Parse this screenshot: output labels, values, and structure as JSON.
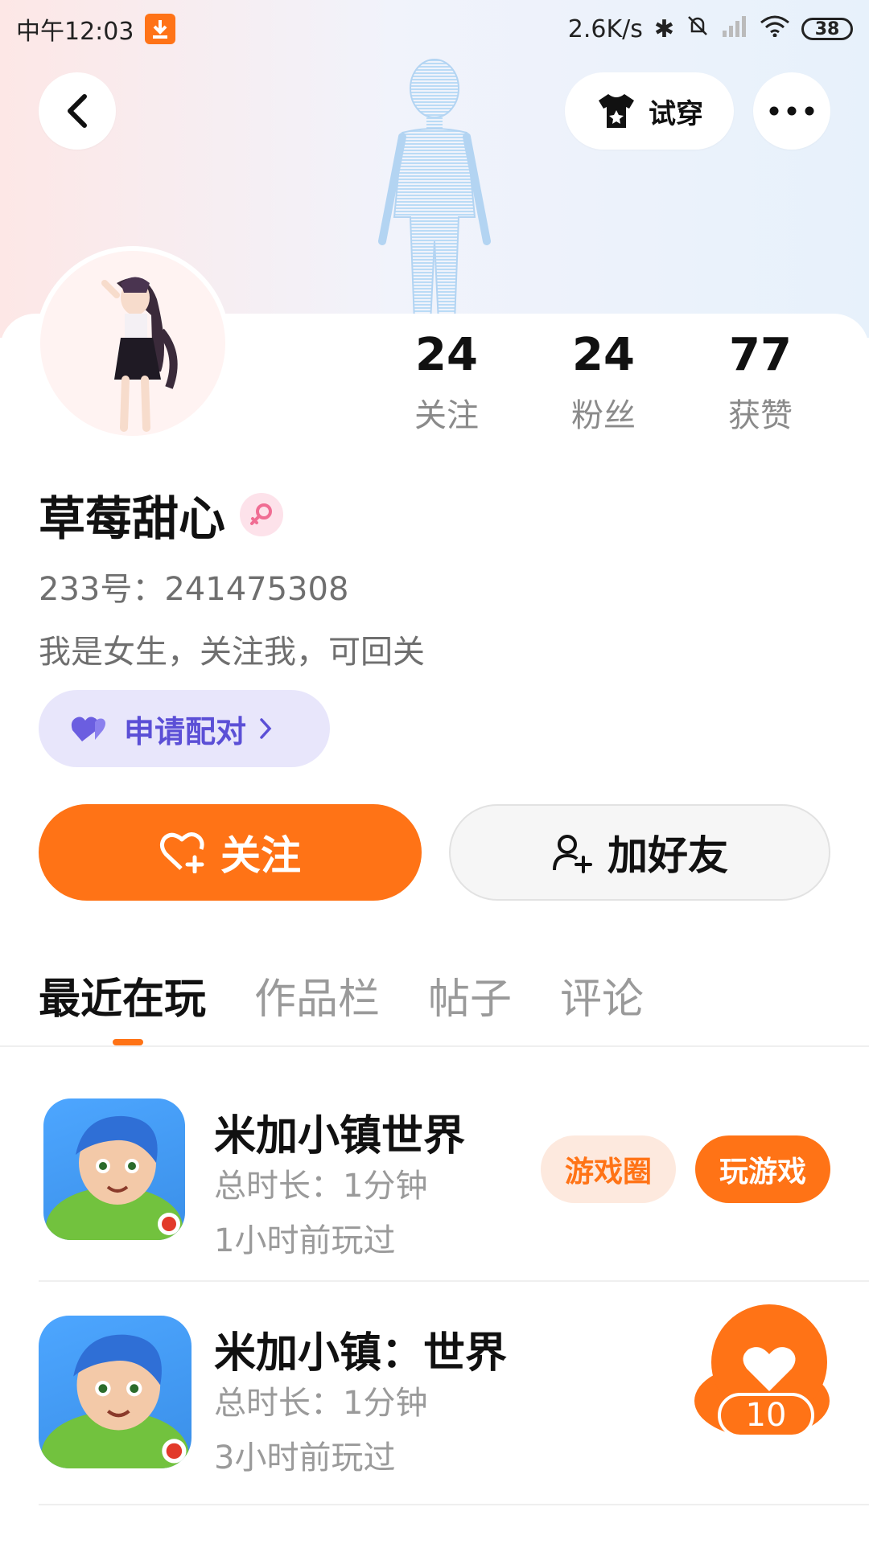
{
  "status_bar": {
    "time": "中午12:03",
    "network_speed": "2.6K/s",
    "battery": "38"
  },
  "header": {
    "try_on_label": "试穿"
  },
  "profile": {
    "name": "草莓甜心",
    "uid_line": "233号：241475308",
    "bio": "我是女生，关注我，可回关",
    "gender": "female",
    "stats": [
      {
        "value": "24",
        "label": "关注"
      },
      {
        "value": "24",
        "label": "粉丝"
      },
      {
        "value": "77",
        "label": "获赞"
      }
    ]
  },
  "actions": {
    "pair_label": "申请配对",
    "follow_label": "关注",
    "add_friend_label": "加好友"
  },
  "tabs": [
    {
      "label": "最近在玩",
      "active": true
    },
    {
      "label": "作品栏",
      "active": false
    },
    {
      "label": "帖子",
      "active": false
    },
    {
      "label": "评论",
      "active": false
    }
  ],
  "games": [
    {
      "title": "米加小镇世界",
      "duration": "总时长：1分钟",
      "last_played": "1小时前玩过",
      "circle_label": "游戏圈",
      "play_label": "玩游戏"
    },
    {
      "title": "米加小镇：世界",
      "duration": "总时长：1分钟",
      "last_played": "3小时前玩过"
    }
  ],
  "like_fab": {
    "count": "10"
  },
  "colors": {
    "accent": "#ff7316",
    "pair_bg": "#e8e6fb",
    "pair_text": "#5b4fd6"
  }
}
